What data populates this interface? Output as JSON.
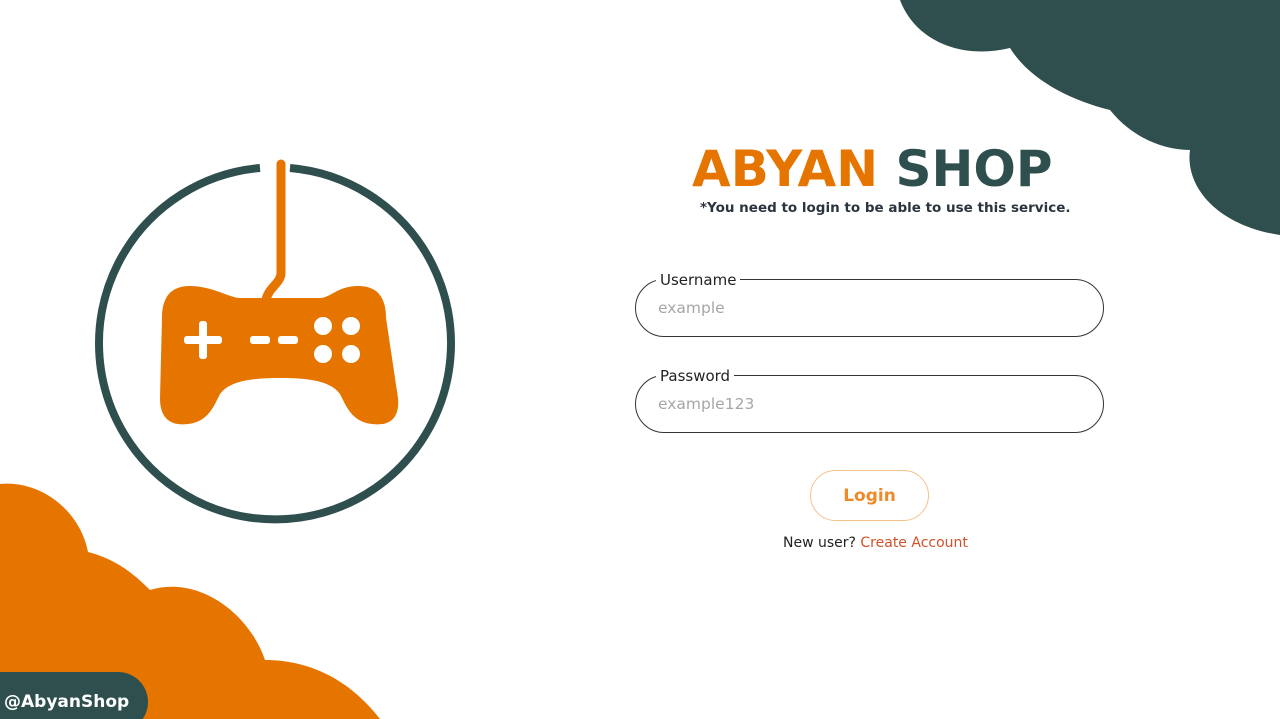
{
  "brand": {
    "title_part1": "ABYAN",
    "title_part2": "SHOP",
    "notice": "*You need to login to be able to use this service."
  },
  "form": {
    "username_label": "Username",
    "username_placeholder": "example",
    "password_label": "Password",
    "password_placeholder": "example123",
    "login_label": "Login",
    "new_user_text": "New user?",
    "create_account_link": "Create Account"
  },
  "footer": {
    "handle": "@AbyanShop"
  },
  "colors": {
    "accent_orange": "#e67500",
    "dark_teal": "#2f4f4f",
    "link_red": "#d2502a"
  },
  "icons": {
    "logo": "gamepad-icon"
  }
}
